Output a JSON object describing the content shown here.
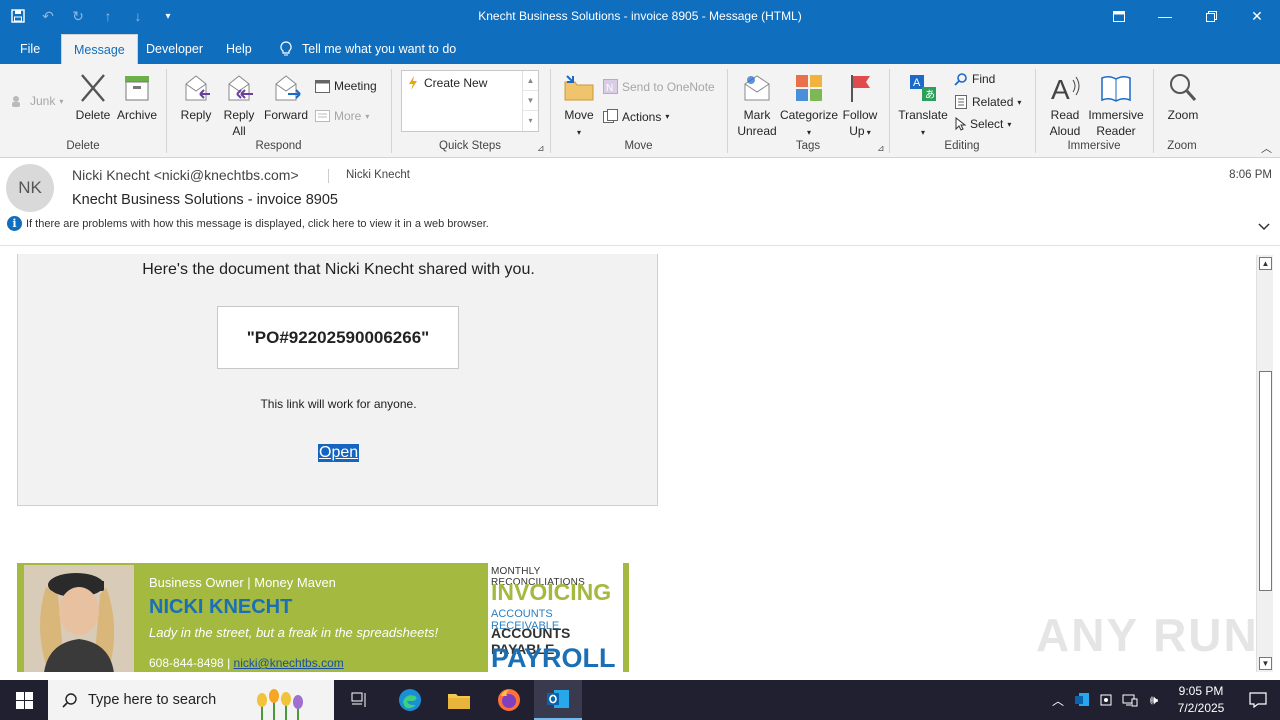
{
  "window": {
    "title": "Knecht Business Solutions - invoice 8905  -  Message (HTML)"
  },
  "tabs": [
    {
      "label": "File"
    },
    {
      "label": "Message"
    },
    {
      "label": "Developer"
    },
    {
      "label": "Help"
    }
  ],
  "tell_me": "Tell me what you want to do",
  "ribbon": {
    "junk": "Junk",
    "delete": "Delete",
    "archive": "Archive",
    "group_delete": "Delete",
    "reply": "Reply",
    "reply_all_1": "Reply",
    "reply_all_2": "All",
    "forward": "Forward",
    "meeting": "Meeting",
    "more": "More",
    "group_respond": "Respond",
    "create_new": "Create New",
    "group_quicksteps": "Quick Steps",
    "move": "Move",
    "send_onenote": "Send to OneNote",
    "actions": "Actions",
    "group_move": "Move",
    "mark_unread_1": "Mark",
    "mark_unread_2": "Unread",
    "categorize": "Categorize",
    "follow_up_1": "Follow",
    "follow_up_2": "Up",
    "group_tags": "Tags",
    "translate": "Translate",
    "find": "Find",
    "related": "Related",
    "select": "Select",
    "group_editing": "Editing",
    "read_aloud_1": "Read",
    "read_aloud_2": "Aloud",
    "immersive_1": "Immersive",
    "immersive_2": "Reader",
    "group_immersive": "Immersive",
    "zoom": "Zoom",
    "group_zoom": "Zoom"
  },
  "message": {
    "avatar_initials": "NK",
    "from": "Nicki Knecht <nicki@knechtbs.com>",
    "to": "Nicki Knecht",
    "time": "8:06 PM",
    "subject": "Knecht Business Solutions - invoice 8905",
    "info": "If there are problems with how this message is displayed, click here to view it in a web browser."
  },
  "body": {
    "lead": "Here's the document that Nicki Knecht shared with you.",
    "po": "\"PO#92202590006266\"",
    "note": "This link will work for anyone.",
    "open": "Open"
  },
  "signature": {
    "role": "Business Owner  |  Money Maven",
    "name": "NICKI KNECHT",
    "tagline": "Lady in the street, but a freak in the spreadsheets!",
    "phone": "608-844-8498 | ",
    "email": "nicki@knechtbs.com",
    "services": [
      "MONTHLY RECONCILIATIONS",
      "INVOICING",
      "ACCOUNTS RECEIVABLE",
      "ACCOUNTS PAYABLE",
      "PAYROLL"
    ]
  },
  "watermark": "ANY RUN",
  "taskbar": {
    "search_placeholder": "Type here to search",
    "time": "9:05 PM",
    "date": "7/2/2025"
  },
  "colors": {
    "accent": "#106ebe",
    "signature_green": "#a3b940",
    "signature_blue": "#1a6fb5"
  }
}
